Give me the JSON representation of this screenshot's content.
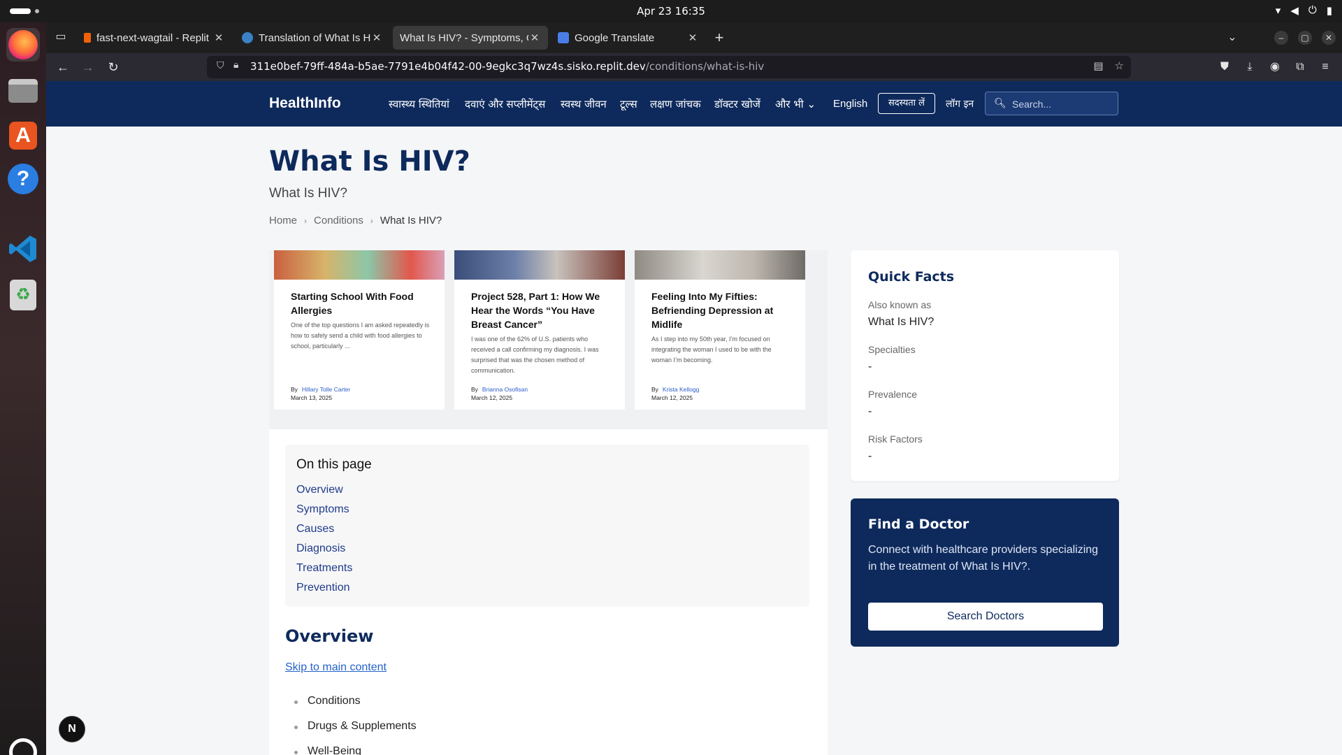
{
  "os": {
    "clock": "Apr 23  16:35"
  },
  "browser": {
    "tabs": [
      {
        "title": "fast-next-wagtail - Replit"
      },
      {
        "title": "Translation of What Is HIV?"
      },
      {
        "title": "What Is HIV? - Symptoms, Ca"
      },
      {
        "title": "Google Translate"
      }
    ],
    "url_host": "311e0bef-79ff-484a-b5ae-7791e4b04f42-00-9egkc3q7wz4s.sisko.replit.dev",
    "url_path": "/conditions/what-is-hiv"
  },
  "site": {
    "logo": "HealthInfo",
    "nav": [
      "स्वास्थ्य स्थितियां",
      "दवाएं और सप्लीमेंट्स",
      "स्वस्थ जीवन",
      "टूल्स",
      "लक्षण जांचक",
      "डॉक्टर खोजें",
      "और भी"
    ],
    "language": "English",
    "subscribe": "सदस्यता लें",
    "login": "लॉग इन",
    "search_placeholder": "Search..."
  },
  "page": {
    "title": "What Is HIV?",
    "subtitle": "What Is HIV?",
    "breadcrumb": [
      "Home",
      "Conditions",
      "What Is HIV?"
    ]
  },
  "articles": [
    {
      "title": "Starting School With Food Allergies",
      "excerpt": "One of the top questions I am asked repeatedly is how to safely send a child with food allergies to school, particularly ...",
      "by": "By",
      "author": "Hillary Tolle Carter",
      "date": "March 13, 2025"
    },
    {
      "title": "Project 528, Part 1: How We Hear the Words “You Have Breast Cancer”",
      "excerpt": "I was one of the 62% of U.S. patients who received a call confirming my diagnosis. I was surprised that was the chosen method of communication.",
      "by": "By",
      "author": "Brianna Osofisan",
      "date": "March 12, 2025"
    },
    {
      "title": "Feeling Into My Fifties: Befriending Depression at Midlife",
      "excerpt": "As I step into my 50th year, I’m focused on integrating the woman I used to be with the woman I’m becoming.",
      "by": "By",
      "author": "Krista Kellogg",
      "date": "March 12, 2025"
    }
  ],
  "toc": {
    "title": "On this page",
    "links": [
      "Overview",
      "Symptoms",
      "Causes",
      "Diagnosis",
      "Treatments",
      "Prevention"
    ]
  },
  "overview": {
    "heading": "Overview",
    "skip_link": "Skip to main content",
    "items": [
      "Conditions",
      "Drugs & Supplements",
      "Well-Being"
    ]
  },
  "quick_facts": {
    "title": "Quick Facts",
    "facts": [
      {
        "label": "Also known as",
        "value": "What Is HIV?"
      },
      {
        "label": "Specialties",
        "value": "-"
      },
      {
        "label": "Prevalence",
        "value": "-"
      },
      {
        "label": "Risk Factors",
        "value": "-"
      }
    ]
  },
  "find_doctor": {
    "title": "Find a Doctor",
    "text": "Connect with healthcare providers specializing in the treatment of What Is HIV?.",
    "button": "Search Doctors"
  },
  "dev_badge": "N"
}
